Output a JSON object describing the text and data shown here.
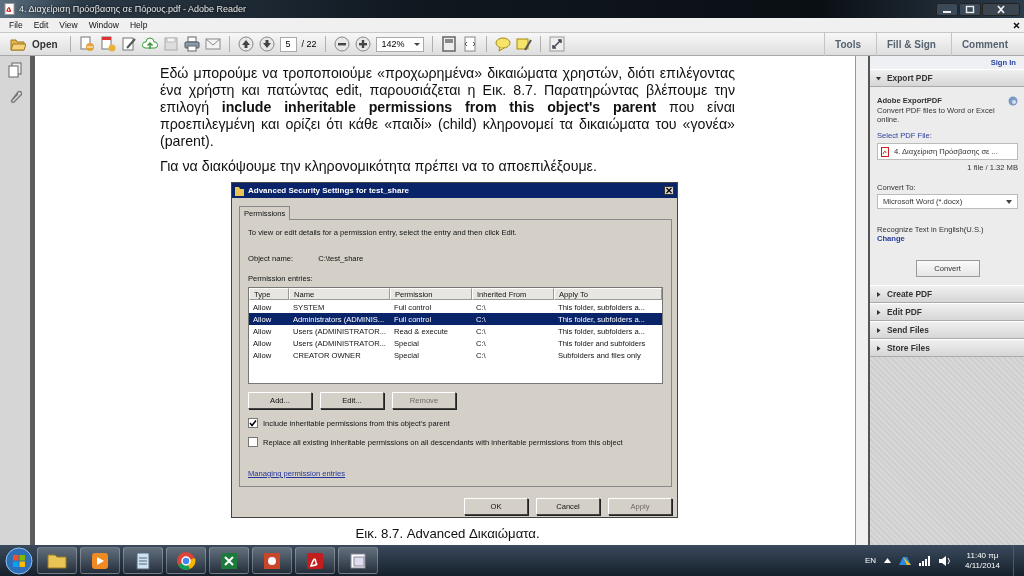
{
  "window": {
    "title": "4. Διαχείριση Πρόσβασης σε Πόρους.pdf - Adobe Reader"
  },
  "menu": [
    "File",
    "Edit",
    "View",
    "Window",
    "Help"
  ],
  "toolbar": {
    "open_label": "Open",
    "page": "5",
    "page_total": "/ 22",
    "zoom": "142%",
    "panel_tabs": [
      "Tools",
      "Fill & Sign",
      "Comment"
    ]
  },
  "document": {
    "paragraphs": [
      "Εδώ μπορούμε να τροποποιούμε «προχωρημένα» δικαιώματα χρηστών, διότι επιλέγοντας ένα χρήστη και πατώντας edit, παρουσιάζεται η Εικ. 8.7. Παρατηρώντας βλέπουμε την επιλογή **include inheritable permissions from this object's parent** που είναι προεπιλεγμένη και ορίζει ότι κάθε «παιδί» (child) κληρονομεί τα δικαιώματα του «γονέα» (parent).",
      "Για να διακόψουμε την κληρονομικότητα πρέπει να το αποεπιλέξουμε."
    ],
    "caption": "Εικ. 8.7. Advanced Δικαιώματα."
  },
  "dialog": {
    "title": "Advanced Security Settings for test_share",
    "tab": "Permissions",
    "instructions": "To view or edit details for a permission entry, select the entry and then click Edit.",
    "object_label": "Object name:",
    "object_value": "C:\\test_share",
    "entries_label": "Permission entries:",
    "columns": [
      "Type",
      "Name",
      "Permission",
      "Inherited From",
      "Apply To"
    ],
    "rows": [
      {
        "cells": [
          "Allow",
          "SYSTEM",
          "Full control",
          "C:\\",
          "This folder, subfolders a..."
        ],
        "selected": false
      },
      {
        "cells": [
          "Allow",
          "Administrators (ADMINIS...",
          "Full control",
          "C:\\",
          "This folder, subfolders a..."
        ],
        "selected": true
      },
      {
        "cells": [
          "Allow",
          "Users (ADMINISTRATOR...",
          "Read & execute",
          "C:\\",
          "This folder, subfolders a..."
        ],
        "selected": false
      },
      {
        "cells": [
          "Allow",
          "Users (ADMINISTRATOR...",
          "Special",
          "C:\\",
          "This folder and subfolders"
        ],
        "selected": false
      },
      {
        "cells": [
          "Allow",
          "CREATOR OWNER",
          "Special",
          "C:\\",
          "Subfolders and files only"
        ],
        "selected": false
      }
    ],
    "buttons": [
      {
        "label": "Add...",
        "disabled": false
      },
      {
        "label": "Edit...",
        "disabled": false
      },
      {
        "label": "Remove",
        "disabled": true
      }
    ],
    "checkboxes": [
      {
        "label": "Include inheritable permissions from this object's parent",
        "checked": true
      },
      {
        "label": "Replace all existing inheritable permissions on all descendants with inheritable permissions from this object",
        "checked": false
      }
    ],
    "link": "Managing permission entries",
    "footer_buttons": [
      {
        "label": "OK",
        "disabled": false
      },
      {
        "label": "Cancel",
        "disabled": false
      },
      {
        "label": "Apply",
        "disabled": true
      }
    ]
  },
  "side_panel": {
    "sign_in": "Sign In",
    "sections": [
      {
        "title": "Export PDF",
        "expanded": true
      },
      {
        "title": "Create PDF",
        "expanded": false
      },
      {
        "title": "Edit PDF",
        "expanded": false
      },
      {
        "title": "Send Files",
        "expanded": false
      },
      {
        "title": "Store Files",
        "expanded": false
      }
    ],
    "export": {
      "heading": "Adobe ExportPDF",
      "description": "Convert PDF files to Word or Excel online.",
      "select_label": "Select PDF File:",
      "file": "4. Διαχείριση Πρόσβασης σε ...",
      "file_info": "1 file / 1.32 MB",
      "convert_label": "Convert To:",
      "convert_to": "Microsoft Word (*.docx)",
      "recognize": "Recognize Text in English(U.S.)",
      "change": "Change",
      "convert_button": "Convert"
    }
  },
  "taskbar": {
    "language": "EN",
    "time": "11:40 πμ",
    "date": "4/11/2014"
  }
}
